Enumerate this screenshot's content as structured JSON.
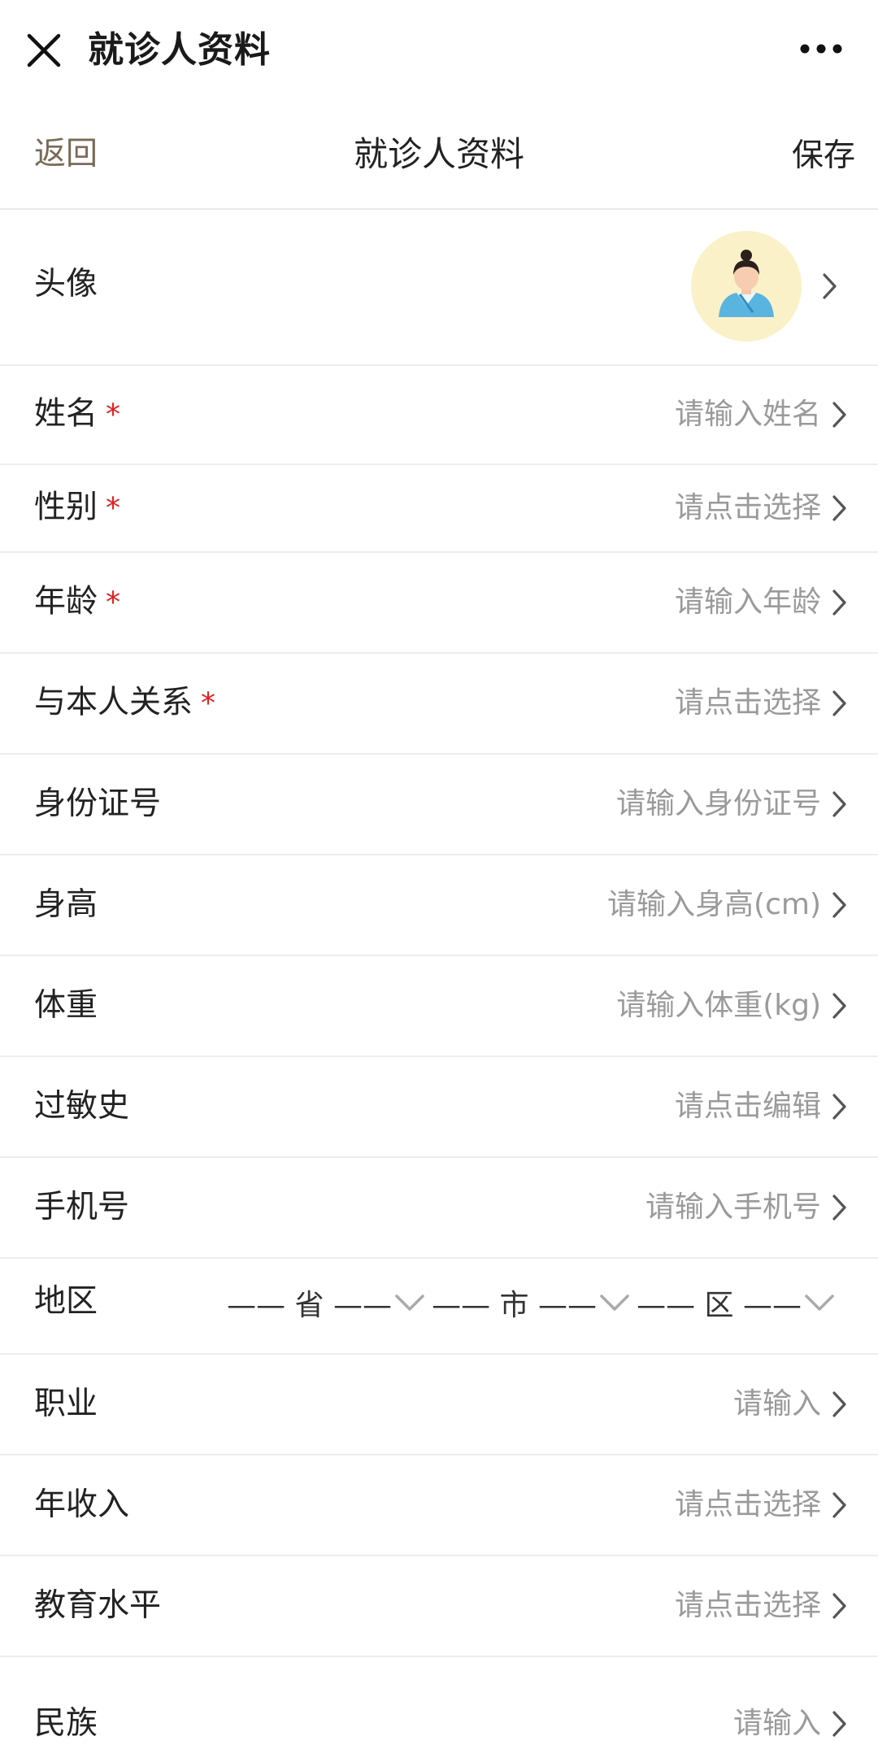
{
  "topbar": {
    "title": "就诊人资料",
    "close_icon": "close-icon",
    "more_icon": "more-dots-icon"
  },
  "navbar": {
    "back_label": "返回",
    "title": "就诊人资料",
    "save_label": "保存"
  },
  "avatar": {
    "label": "头像",
    "icon": "avatar-icon"
  },
  "form": {
    "rows": [
      {
        "label": "姓名",
        "required": true,
        "placeholder": "请输入姓名"
      },
      {
        "label": "性别",
        "required": true,
        "placeholder": "请点击选择"
      },
      {
        "label": "年龄",
        "required": true,
        "placeholder": "请输入年龄"
      },
      {
        "label": "与本人关系",
        "required": true,
        "placeholder": "请点击选择"
      },
      {
        "label": "身份证号",
        "required": false,
        "placeholder": "请输入身份证号"
      },
      {
        "label": "身高",
        "required": false,
        "placeholder": "请输入身高(cm)"
      },
      {
        "label": "体重",
        "required": false,
        "placeholder": "请输入体重(kg)"
      },
      {
        "label": "过敏史",
        "required": false,
        "placeholder": "请点击编辑"
      },
      {
        "label": "手机号",
        "required": false,
        "placeholder": "请输入手机号"
      }
    ],
    "region": {
      "label": "地区",
      "province": "—— 省 ——",
      "city": "—— 市 ——",
      "district": "—— 区 ——"
    },
    "rows_after": [
      {
        "label": "职业",
        "required": false,
        "placeholder": "请输入"
      },
      {
        "label": "年收入",
        "required": false,
        "placeholder": "请点击选择"
      },
      {
        "label": "教育水平",
        "required": false,
        "placeholder": "请点击选择"
      },
      {
        "label": "民族",
        "required": false,
        "placeholder": "请输入"
      }
    ],
    "required_mark": "*"
  },
  "colors": {
    "back": "#7a6a58",
    "required": "#e02020",
    "placeholder": "#9a9a9a",
    "avatar_bg": "#fbf1c8"
  }
}
